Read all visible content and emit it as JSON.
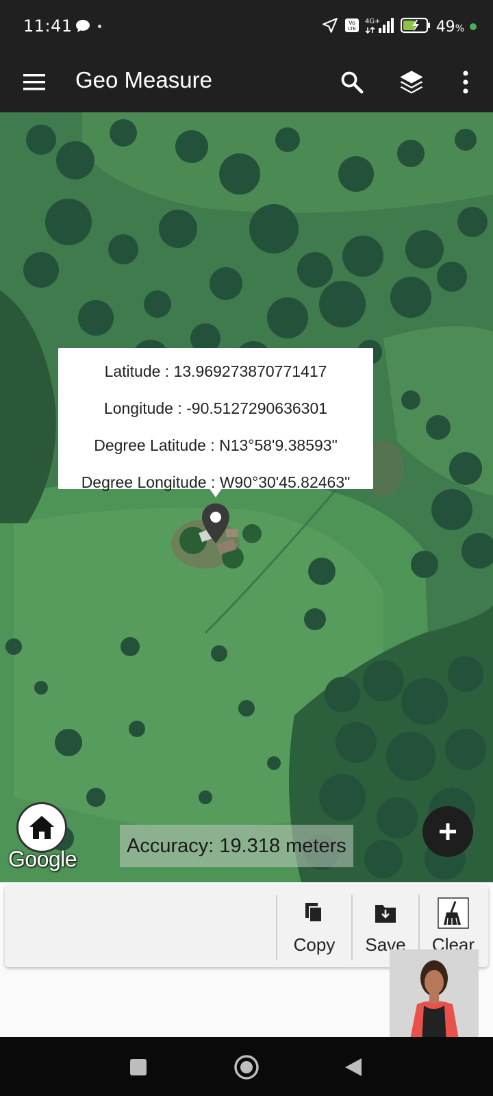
{
  "status_bar": {
    "time": "11:41",
    "battery_percent": "49",
    "battery_unit": "%",
    "network": "4G+",
    "volte": "Vo LTE",
    "icons": [
      "chat-bubble-icon",
      "dot-icon",
      "location-arrow-icon",
      "volte-icon",
      "signal-icon",
      "battery-charging-icon",
      "green-dot-icon"
    ]
  },
  "app_bar": {
    "title": "Geo Measure",
    "icons": [
      "menu-icon",
      "search-icon",
      "layers-icon",
      "more-vert-icon"
    ]
  },
  "map": {
    "info": {
      "latitude": "Latitude : 13.969273870771417",
      "longitude": "Longitude : -90.5127290636301",
      "degree_latitude": "Degree Latitude : N13°58'9.38593\"",
      "degree_longitude": "Degree Longitude : W90°30'45.82463\""
    },
    "accuracy": "Accuracy: 19.318 meters",
    "google_label": "Google"
  },
  "toolbar": {
    "copy_label": "Copy",
    "save_label": "Save",
    "clear_label": "Clear"
  },
  "colors": {
    "app_bar": "#202020",
    "accent_green": "#4caf50",
    "map_green": "#3d7a4a"
  }
}
